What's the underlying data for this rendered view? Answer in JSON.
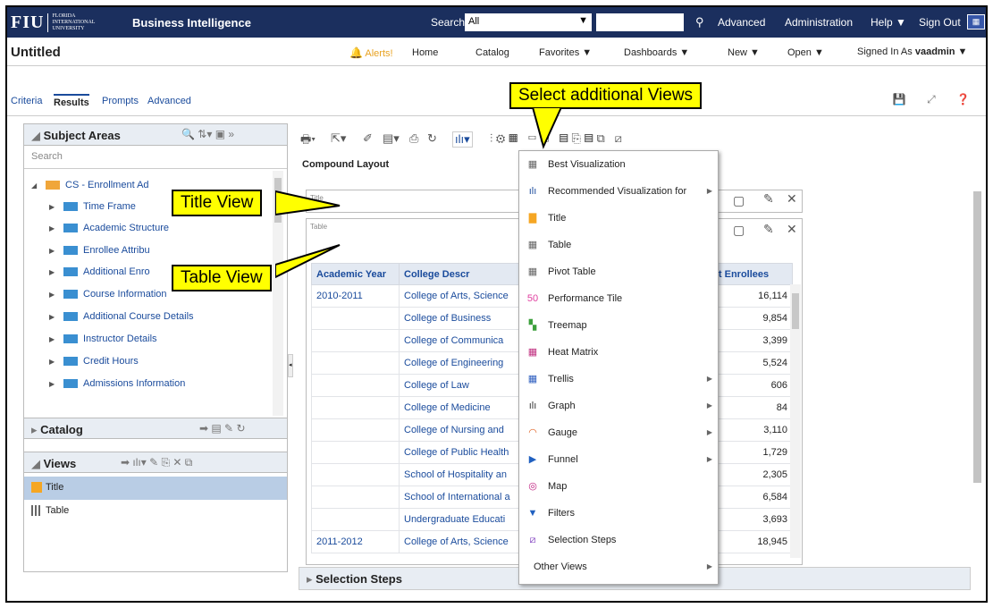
{
  "topbar": {
    "logo_main": "FIU",
    "logo_sub1": "FLORIDA",
    "logo_sub2": "INTERNATIONAL",
    "logo_sub3": "UNIVERSITY",
    "app_title": "Business Intelligence",
    "search_label": "Search",
    "search_scope": "All",
    "search_placeholder": "",
    "advanced": "Advanced",
    "administration": "Administration",
    "help": "Help ▼",
    "sign_out": "Sign Out"
  },
  "header": {
    "page_title": "Untitled",
    "alerts": "Alerts!",
    "home": "Home",
    "catalog": "Catalog",
    "favorites": "Favorites ▼",
    "dashboards": "Dashboards ▼",
    "new": "New ▼",
    "open": "Open ▼",
    "signed_in_label": "Signed In As",
    "user": "vaadmin ▼"
  },
  "tabs": [
    "Criteria",
    "Results",
    "Prompts",
    "Advanced"
  ],
  "left": {
    "subject_areas_label": "Subject Areas",
    "search_placeholder": "Search",
    "tree": [
      "CS - Enrollment Ad",
      "Time Frame",
      "Academic Structure",
      "Enrollee Attribu",
      "Additional Enro",
      "Course Information",
      "Additional Course Details",
      "Instructor Details",
      "Credit Hours",
      "Admissions Information"
    ],
    "catalog_label": "Catalog",
    "views_label": "Views",
    "views": [
      "Title",
      "Table"
    ]
  },
  "main": {
    "compound_layout": "Compound Layout",
    "title_view_label": "Title",
    "table_view_label": "Table",
    "selection_steps": "Selection Steps",
    "table": {
      "headers": [
        "Academic Year",
        "College Descr",
        "inct Enrollees"
      ],
      "rows": [
        [
          "2010-2011",
          "College of Arts, Science",
          "16,114"
        ],
        [
          "",
          "College of Business",
          "9,854"
        ],
        [
          "",
          "College of Communica",
          "3,399"
        ],
        [
          "",
          "College of Engineering",
          "5,524"
        ],
        [
          "",
          "College of Law",
          "606"
        ],
        [
          "",
          "College of Medicine",
          "84"
        ],
        [
          "",
          "College of Nursing and",
          "3,110"
        ],
        [
          "",
          "College of Public Health",
          "1,729"
        ],
        [
          "",
          "School of Hospitality an",
          "2,305"
        ],
        [
          "",
          "School of International a",
          "6,584"
        ],
        [
          "",
          "Undergraduate Educati",
          "3,693"
        ],
        [
          "2011-2012",
          "College of Arts, Science",
          "18,945"
        ]
      ]
    }
  },
  "menu": {
    "items": [
      {
        "label": "Best Visualization",
        "icon": "grid-icon",
        "sub": false
      },
      {
        "label": "Recommended Visualization for",
        "icon": "bar-chart-icon",
        "sub": true
      },
      {
        "label": "Title",
        "icon": "title-icon",
        "sub": false
      },
      {
        "label": "Table",
        "icon": "table-icon",
        "sub": false
      },
      {
        "label": "Pivot Table",
        "icon": "pivot-icon",
        "sub": false
      },
      {
        "label": "Performance Tile",
        "icon": "tile-icon",
        "sub": false
      },
      {
        "label": "Treemap",
        "icon": "treemap-icon",
        "sub": false
      },
      {
        "label": "Heat Matrix",
        "icon": "heat-icon",
        "sub": false
      },
      {
        "label": "Trellis",
        "icon": "trellis-icon",
        "sub": true
      },
      {
        "label": "Graph",
        "icon": "graph-icon",
        "sub": true
      },
      {
        "label": "Gauge",
        "icon": "gauge-icon",
        "sub": true
      },
      {
        "label": "Funnel",
        "icon": "funnel-icon",
        "sub": true
      },
      {
        "label": "Map",
        "icon": "globe-icon",
        "sub": false
      },
      {
        "label": "Filters",
        "icon": "filter-icon",
        "sub": false
      },
      {
        "label": "Selection Steps",
        "icon": "steps-icon",
        "sub": false
      },
      {
        "label": "Other Views",
        "icon": "",
        "sub": true
      }
    ]
  },
  "callouts": {
    "views": "Select additional Views",
    "title": "Title View",
    "table": "Table View"
  },
  "colors": {
    "topbar": "#1b2f5e",
    "callout": "#ffff00",
    "link": "#1a4b9c",
    "selected_row": "#b9cde5"
  }
}
